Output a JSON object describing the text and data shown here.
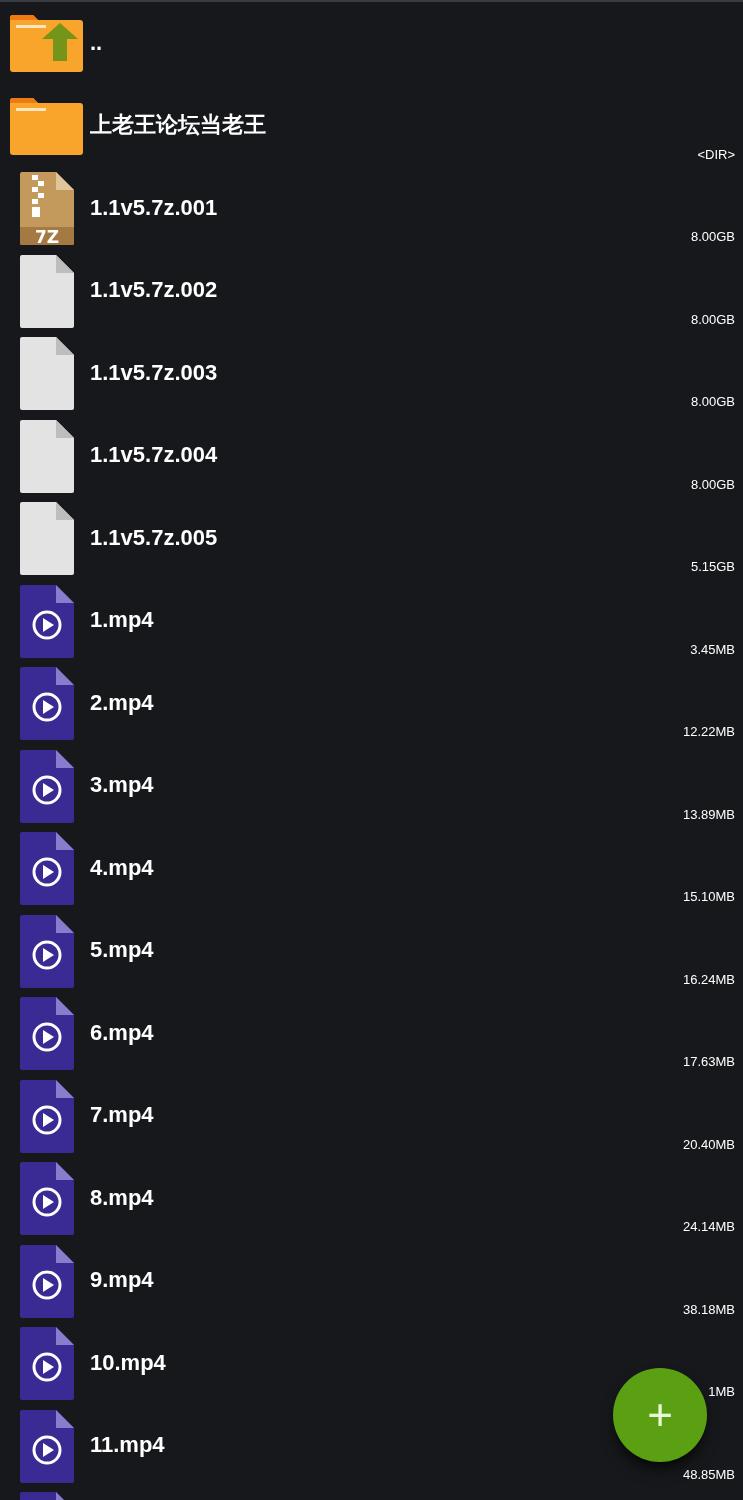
{
  "files": [
    {
      "kind": "parent",
      "name": ".."
    },
    {
      "kind": "folder",
      "name": "上老王论坛当老王",
      "size": "<DIR>"
    },
    {
      "kind": "archive",
      "name": "1.1v5.7z.001",
      "size": "8.00GB",
      "badge": "7Z"
    },
    {
      "kind": "file",
      "name": "1.1v5.7z.002",
      "size": "8.00GB"
    },
    {
      "kind": "file",
      "name": "1.1v5.7z.003",
      "size": "8.00GB"
    },
    {
      "kind": "file",
      "name": "1.1v5.7z.004",
      "size": "8.00GB"
    },
    {
      "kind": "file",
      "name": "1.1v5.7z.005",
      "size": "5.15GB"
    },
    {
      "kind": "video",
      "name": "1.mp4",
      "size": "3.45MB"
    },
    {
      "kind": "video",
      "name": "2.mp4",
      "size": "12.22MB"
    },
    {
      "kind": "video",
      "name": "3.mp4",
      "size": "13.89MB"
    },
    {
      "kind": "video",
      "name": "4.mp4",
      "size": "15.10MB"
    },
    {
      "kind": "video",
      "name": "5.mp4",
      "size": "16.24MB"
    },
    {
      "kind": "video",
      "name": "6.mp4",
      "size": "17.63MB"
    },
    {
      "kind": "video",
      "name": "7.mp4",
      "size": "20.40MB"
    },
    {
      "kind": "video",
      "name": "8.mp4",
      "size": "24.14MB"
    },
    {
      "kind": "video",
      "name": "9.mp4",
      "size": "38.18MB"
    },
    {
      "kind": "video",
      "name": "10.mp4",
      "size": "1MB"
    },
    {
      "kind": "video",
      "name": "11.mp4",
      "size": "48.85MB"
    },
    {
      "kind": "video"
    }
  ],
  "fab": {
    "label": "+"
  }
}
